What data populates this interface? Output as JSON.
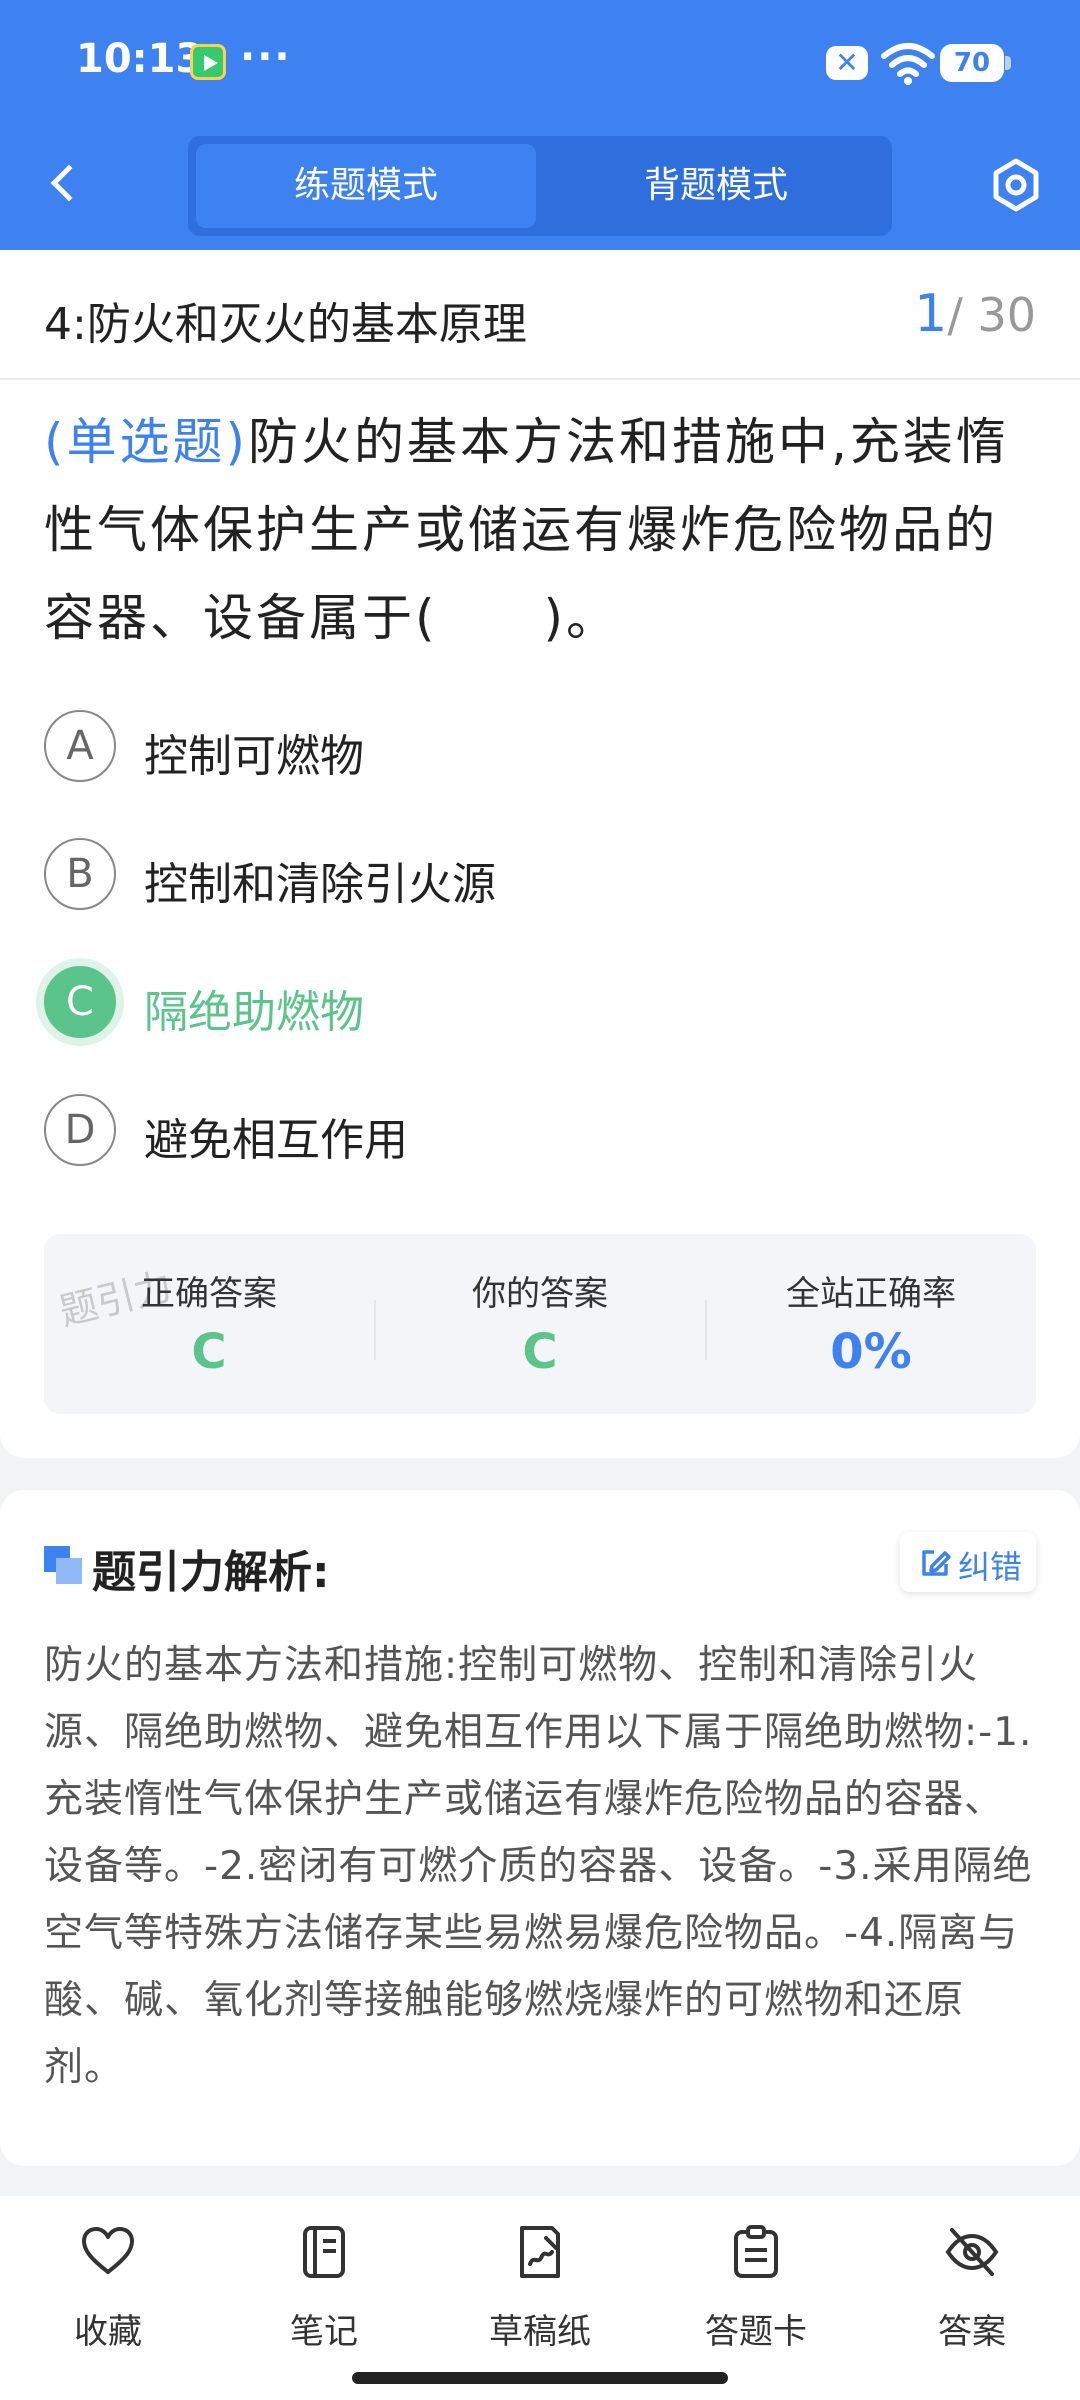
{
  "status_bar": {
    "time": "10:13",
    "more": "···",
    "battery": "70"
  },
  "header": {
    "modes": [
      "练题模式",
      "背题模式"
    ],
    "active_mode": "练题模式"
  },
  "chapter": {
    "title": "4:防火和灭火的基本原理",
    "current": "1",
    "total": "/ 30"
  },
  "question": {
    "type": "(单选题)",
    "text": "防火的基本方法和措施中,充装惰性气体保护生产或储运有爆炸危险物品的容器、设备属于(　　)。",
    "options": [
      {
        "letter": "A",
        "text": "控制可燃物"
      },
      {
        "letter": "B",
        "text": "控制和清除引火源"
      },
      {
        "letter": "C",
        "text": "隔绝助燃物"
      },
      {
        "letter": "D",
        "text": "避免相互作用"
      }
    ],
    "selected": "C"
  },
  "stats": {
    "correct_label": "正确答案",
    "correct_value": "C",
    "yours_label": "你的答案",
    "yours_value": "C",
    "rate_label": "全站正确率",
    "rate_value": "0%",
    "watermark": "题引力"
  },
  "analysis": {
    "title": "题引力解析:",
    "report_label": "纠错",
    "body": "防火的基本方法和措施:控制可燃物、控制和清除引火源、隔绝助燃物、避免相互作用以下属于隔绝助燃物:-1.充装惰性气体保护生产或储运有爆炸危险物品的容器、设备等。-2.密闭有可燃介质的容器、设备。-3.采用隔绝空气等特殊方法储存某些易燃易爆危险物品。-4.隔离与酸、碱、氧化剂等接触能够燃烧爆炸的可燃物和还原剂。"
  },
  "bottom_nav": [
    {
      "label": "收藏",
      "icon": "heart-icon"
    },
    {
      "label": "笔记",
      "icon": "notebook-icon"
    },
    {
      "label": "草稿纸",
      "icon": "draft-paper-icon"
    },
    {
      "label": "答题卡",
      "icon": "answer-card-icon"
    },
    {
      "label": "答案",
      "icon": "eye-off-icon"
    }
  ],
  "colors": {
    "primary": "#3d82f0",
    "correct": "#5ac48a"
  }
}
